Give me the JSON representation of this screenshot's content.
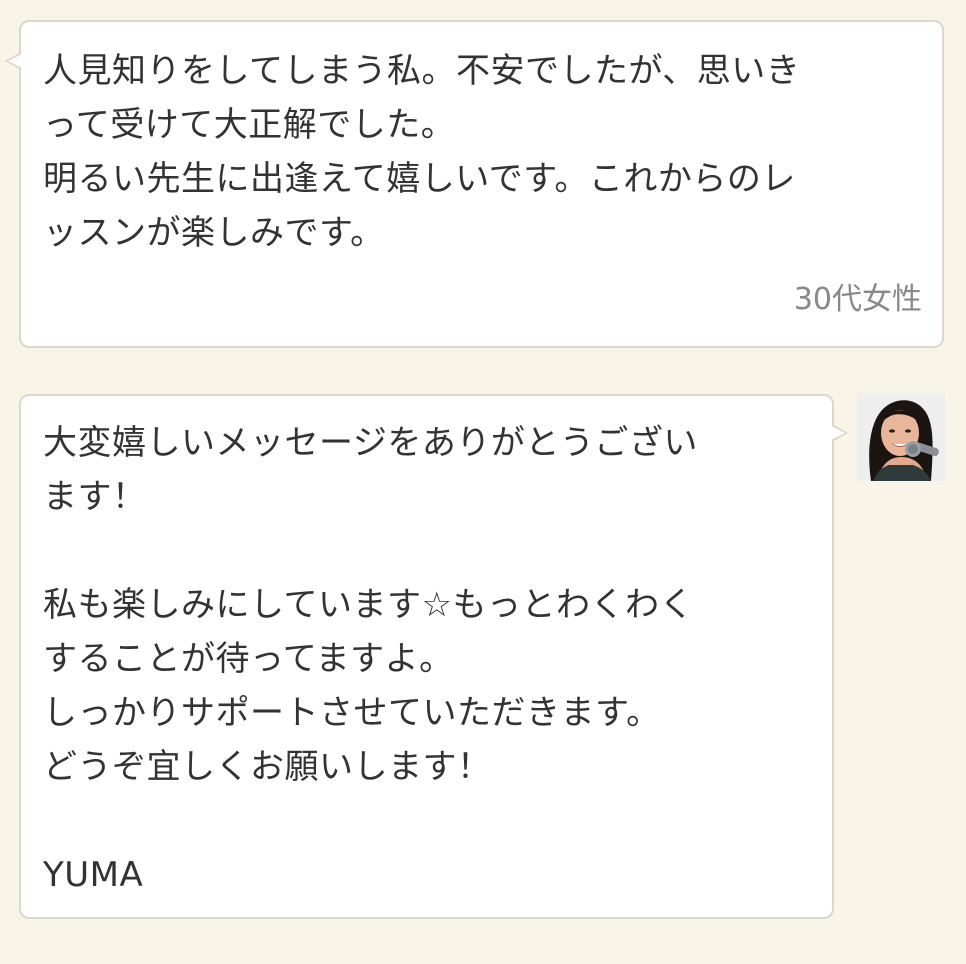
{
  "review": {
    "lines": [
      "人見知りをしてしまう私。不安でしたが、思いき",
      "って受けて大正解でした。",
      "明るい先生に出逢えて嬉しいです。これからのレ",
      "ッスンが楽しみです。"
    ],
    "author": "30代女性"
  },
  "reply": {
    "lines": [
      "大変嬉しいメッセージをありがとうござい",
      "ます！",
      "",
      "私も楽しみにしています☆もっとわくわく",
      "することが待ってますよ。",
      "しっかりサポートさせていただきます。",
      "どうぞ宜しくお願いします！",
      "",
      "YUMA"
    ]
  },
  "colors": {
    "background": "#f9f4e8",
    "bubble": "#ffffff",
    "bubble_border": "#dcd7cc",
    "text": "#333333",
    "author_text": "#888888"
  },
  "icons": {
    "avatar": "teacher-avatar-photo"
  }
}
